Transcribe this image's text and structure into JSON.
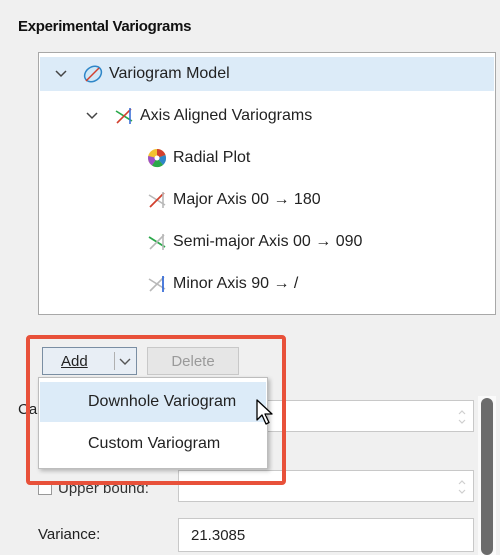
{
  "section": {
    "title": "Experimental Variograms"
  },
  "tree": [
    {
      "label": "Variogram Model",
      "icon": "variogram-model-icon",
      "level": 0,
      "expanded": true,
      "selected": true
    },
    {
      "label": "Axis Aligned Variograms",
      "icon": "axis-aligned-variograms-icon",
      "level": 1,
      "expanded": true
    },
    {
      "label": "Radial Plot",
      "icon": "radial-plot-icon",
      "level": 2
    },
    {
      "label": "Major Axis 00 → 180",
      "icon": "major-axis-icon",
      "level": 2
    },
    {
      "label": "Semi-major Axis 00 → 090",
      "icon": "semi-major-axis-icon",
      "level": 2
    },
    {
      "label": "Minor Axis 90 → /",
      "icon": "minor-axis-icon",
      "level": 2
    }
  ],
  "toolbar": {
    "add_label": "Add",
    "delete_label": "Delete"
  },
  "dropdown": {
    "items": [
      "Downhole Variogram",
      "Custom Variogram"
    ],
    "highlighted": 0
  },
  "form": {
    "partial_left_label": "Ca",
    "upper_bound_label": "Upper bound:",
    "variance_label": "Variance:",
    "variance_value": "21.3085"
  },
  "colors": {
    "callout": "#e8513a",
    "selection": "#dcebf8"
  }
}
